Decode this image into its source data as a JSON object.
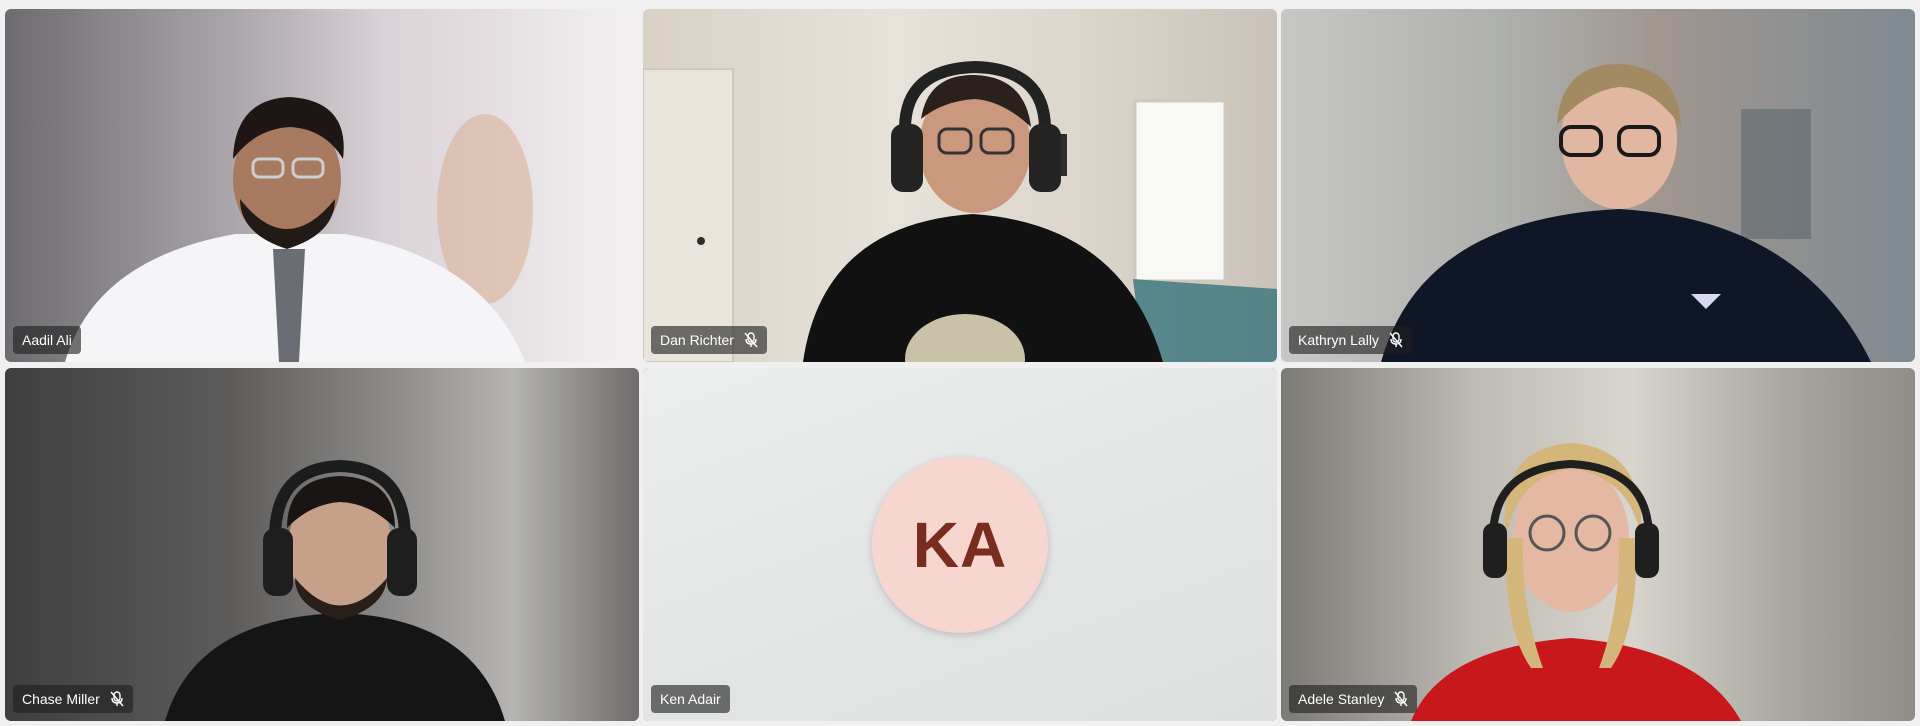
{
  "participants": [
    {
      "name": "Aadil Ali",
      "muted": false,
      "speaking": false
    },
    {
      "name": "Dan Richter",
      "muted": true,
      "speaking": false
    },
    {
      "name": "Kathryn Lally",
      "muted": true,
      "speaking": false
    },
    {
      "name": "Chase Miller",
      "muted": true,
      "speaking": false
    },
    {
      "name": "Ken Adair",
      "muted": false,
      "speaking": true,
      "initials": "KA",
      "video": false
    },
    {
      "name": "Adele Stanley",
      "muted": true,
      "speaking": false
    }
  ],
  "colors": {
    "speaking_border": "#5b5fc7",
    "avatar_bg": "#f6d6cf",
    "avatar_text": "#7a2c1e",
    "nametag_bg": "rgba(30,30,30,0.62)"
  },
  "icons": {
    "mute": "mic-off-icon"
  }
}
